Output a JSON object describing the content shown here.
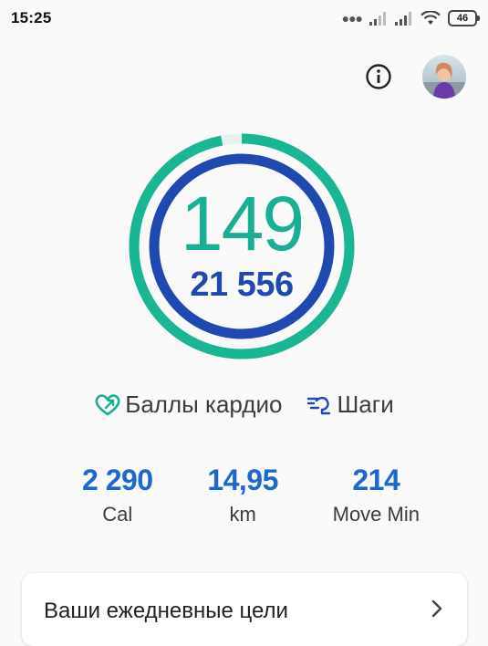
{
  "status_bar": {
    "time": "15:25",
    "battery": "46",
    "icons": [
      "more-dots-icon",
      "signal-icon",
      "signal-icon",
      "wifi-icon",
      "battery-icon"
    ]
  },
  "header": {
    "icons": [
      "info-icon",
      "avatar"
    ]
  },
  "rings": {
    "heart_points": "149",
    "steps": "21 556",
    "heart_progress": 0.97,
    "steps_progress": 1.0,
    "colors": {
      "heart": "#1ab592",
      "steps": "#1f48b0"
    }
  },
  "legend": {
    "heart_label": "Баллы кардио",
    "steps_label": "Шаги"
  },
  "stats": [
    {
      "value": "2 290",
      "label": "Cal"
    },
    {
      "value": "14,95",
      "label": "km"
    },
    {
      "value": "214",
      "label": "Move Min"
    }
  ],
  "goals_card": {
    "title": "Ваши ежедневные цели"
  }
}
